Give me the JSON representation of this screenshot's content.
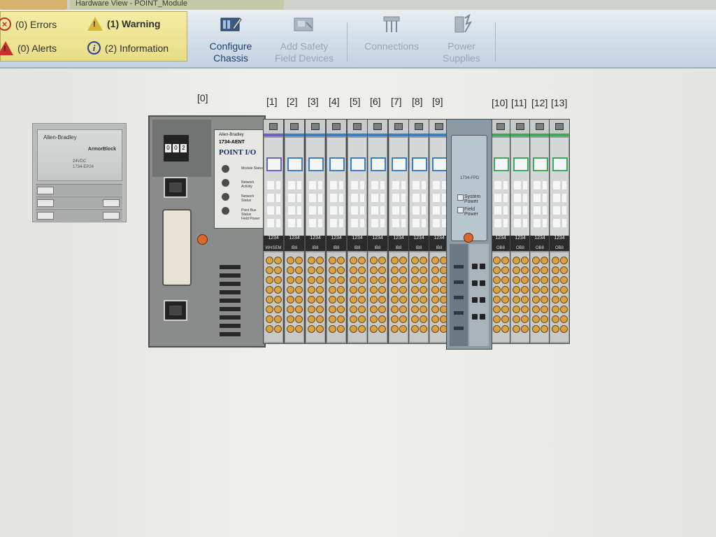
{
  "tabs": [
    "",
    "Hardware View - POINT_Module"
  ],
  "status": {
    "errors": "(0) Errors",
    "warning": "(1) Warning",
    "alerts": "(0) Alerts",
    "information": "(2) Information"
  },
  "ribbon": {
    "configure_chassis": [
      "Configure",
      "Chassis"
    ],
    "add_safety": [
      "Add Safety",
      "Field Devices"
    ],
    "connections": "Connections",
    "power_supplies": [
      "Power",
      "Supplies"
    ]
  },
  "slot_labels": [
    "[0]",
    "[1]",
    "[2]",
    "[3]",
    "[4]",
    "[5]",
    "[6]",
    "[7]",
    "[8]",
    "[9]",
    "[10]",
    "[11]",
    "[12]",
    "[13]"
  ],
  "power_module": {
    "logo": "Allen-Bradley",
    "brand": "ArmorBlock",
    "text": [
      "24VDC",
      "1734-EP24"
    ]
  },
  "adapter": {
    "switch_digits": [
      "0",
      "0",
      "2"
    ],
    "brand": "Allen-Bradley",
    "model": "1734-AENT",
    "series": "POINT I/O",
    "leds": [
      "Module Status",
      "Network Activity",
      "Network Status",
      "Point Bus Status",
      "Field Power"
    ],
    "card_text": "1734-AENT"
  },
  "module_codes": [
    "WHSEM",
    "IB8",
    "IB8",
    "IB8",
    "IB8",
    "IB8",
    "IB8",
    "IB8",
    "IB8",
    "OB8",
    "OB8",
    "OB8",
    "OB8"
  ],
  "module_top_code": "1234",
  "power_supply": {
    "model": "1734-FPD",
    "labels": [
      "System Power",
      "Field Power"
    ]
  },
  "colors": {
    "ribbon_top": "#e8eef2",
    "status_box": "#ede28f",
    "input_band": "#3a7ec8",
    "output_band": "#3bab5a",
    "safety_band": "#6a62c8",
    "terminal_point": "#d9a143",
    "led_orange": "#d8692a"
  },
  "icons": [
    "error-icon",
    "warning-icon",
    "alert-icon",
    "information-icon",
    "configure-chassis-icon",
    "add-safety-icon",
    "connections-icon",
    "power-supplies-icon"
  ]
}
